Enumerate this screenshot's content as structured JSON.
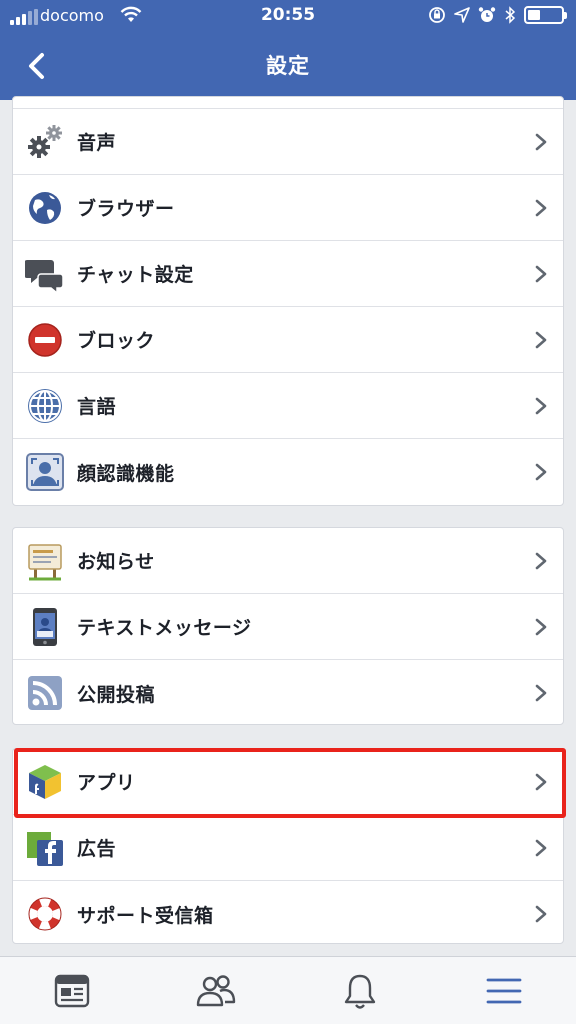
{
  "status_bar": {
    "carrier": "docomo",
    "time": "20:55",
    "battery_level": 0.45
  },
  "header": {
    "title": "設定"
  },
  "groups": [
    {
      "items": [
        {
          "label": "音声",
          "icon": "gears-icon"
        },
        {
          "label": "ブラウザー",
          "icon": "globe-icon"
        },
        {
          "label": "チャット設定",
          "icon": "chat-bubbles-icon"
        },
        {
          "label": "ブロック",
          "icon": "block-icon"
        },
        {
          "label": "言語",
          "icon": "language-globe-icon"
        },
        {
          "label": "顔認識機能",
          "icon": "face-recognition-icon"
        }
      ]
    },
    {
      "items": [
        {
          "label": "お知らせ",
          "icon": "notice-board-icon"
        },
        {
          "label": "テキストメッセージ",
          "icon": "phone-icon"
        },
        {
          "label": "公開投稿",
          "icon": "rss-icon"
        }
      ]
    },
    {
      "items": [
        {
          "label": "アプリ",
          "icon": "apps-cube-icon",
          "highlighted": true
        },
        {
          "label": "広告",
          "icon": "ads-icon"
        },
        {
          "label": "サポート受信箱",
          "icon": "lifebuoy-icon"
        }
      ]
    }
  ],
  "tab_bar": {
    "tabs": [
      {
        "icon": "news-feed-icon",
        "active": false
      },
      {
        "icon": "friends-icon",
        "active": false
      },
      {
        "icon": "bell-icon",
        "active": false
      },
      {
        "icon": "menu-icon",
        "active": true
      }
    ]
  },
  "colors": {
    "brand": "#4267b2",
    "highlight": "#e9231b",
    "active_tab": "#4267b2"
  }
}
